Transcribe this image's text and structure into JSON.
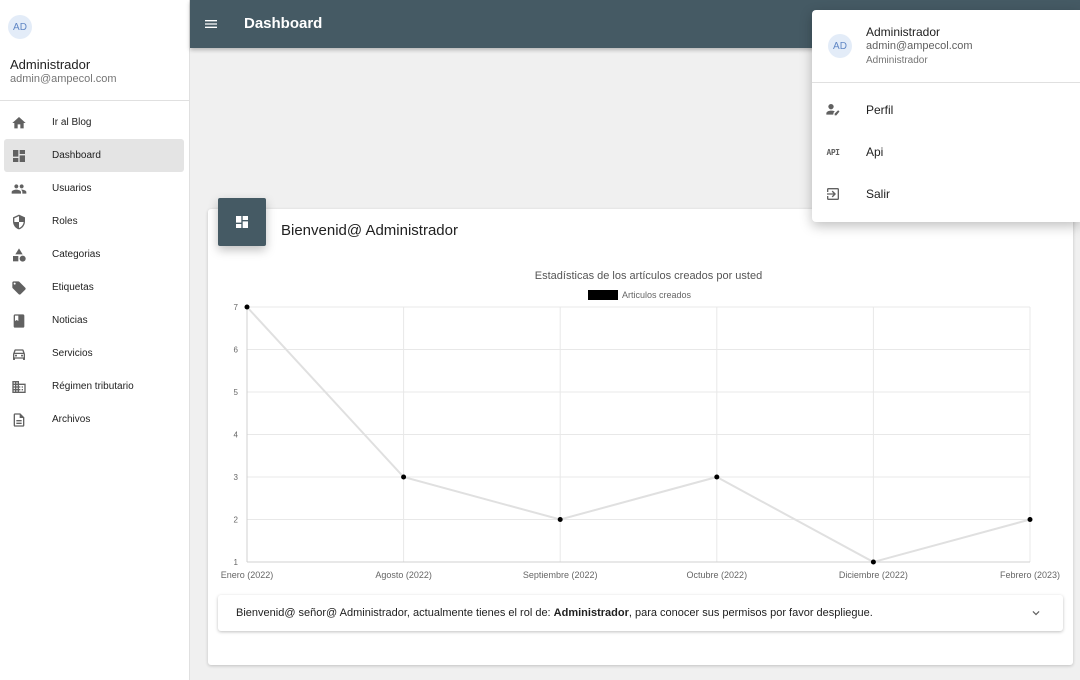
{
  "sidebar": {
    "avatar_initials": "AD",
    "user_name": "Administrador",
    "user_email": "admin@ampecol.com",
    "items": [
      {
        "label": "Ir al Blog",
        "icon": "home-icon",
        "active": false
      },
      {
        "label": "Dashboard",
        "icon": "dashboard-icon",
        "active": true
      },
      {
        "label": "Usuarios",
        "icon": "people-icon",
        "active": false
      },
      {
        "label": "Roles",
        "icon": "shield-icon",
        "active": false
      },
      {
        "label": "Categorias",
        "icon": "category-icon",
        "active": false
      },
      {
        "label": "Etiquetas",
        "icon": "tag-icon",
        "active": false
      },
      {
        "label": "Noticias",
        "icon": "book-icon",
        "active": false
      },
      {
        "label": "Servicios",
        "icon": "car-icon",
        "active": false
      },
      {
        "label": "Régimen tributario",
        "icon": "building-icon",
        "active": false
      },
      {
        "label": "Archivos",
        "icon": "file-icon",
        "active": false
      }
    ]
  },
  "appbar": {
    "title": "Dashboard",
    "color": "#455a64"
  },
  "card": {
    "title": "Bienvenid@ Administrador",
    "icon": "dashboard-icon"
  },
  "chart_data": {
    "type": "line",
    "title": "Estadísticas de los artículos creados por usted",
    "categories": [
      "Enero (2022)",
      "Agosto (2022)",
      "Septiembre (2022)",
      "Octubre (2022)",
      "Diciembre (2022)",
      "Febrero (2023)"
    ],
    "series": [
      {
        "name": "Articulos creados",
        "values": [
          7,
          3,
          2,
          3,
          1,
          2
        ],
        "color": "#e0e0e0",
        "point_color": "#000000"
      }
    ],
    "ylim": [
      1,
      7
    ],
    "yticks": [
      1,
      2,
      3,
      4,
      5,
      6,
      7
    ],
    "grid": true,
    "legend_position": "top"
  },
  "panel": {
    "text_prefix": "Bienvenid@ señor@ Administrador, actualmente tienes el rol de: ",
    "role": "Administrador",
    "text_suffix": ", para conocer sus permisos por favor despliegue.",
    "chevron_icon": "chevron-down-icon"
  },
  "dropdown": {
    "avatar_initials": "AD",
    "name": "Administrador",
    "email": "admin@ampecol.com",
    "role": "Administrador",
    "items": [
      {
        "label": "Perfil",
        "icon": "person-edit-icon"
      },
      {
        "label": "Api",
        "icon": "api-icon",
        "icon_text": "API"
      },
      {
        "label": "Salir",
        "icon": "logout-icon"
      }
    ]
  }
}
